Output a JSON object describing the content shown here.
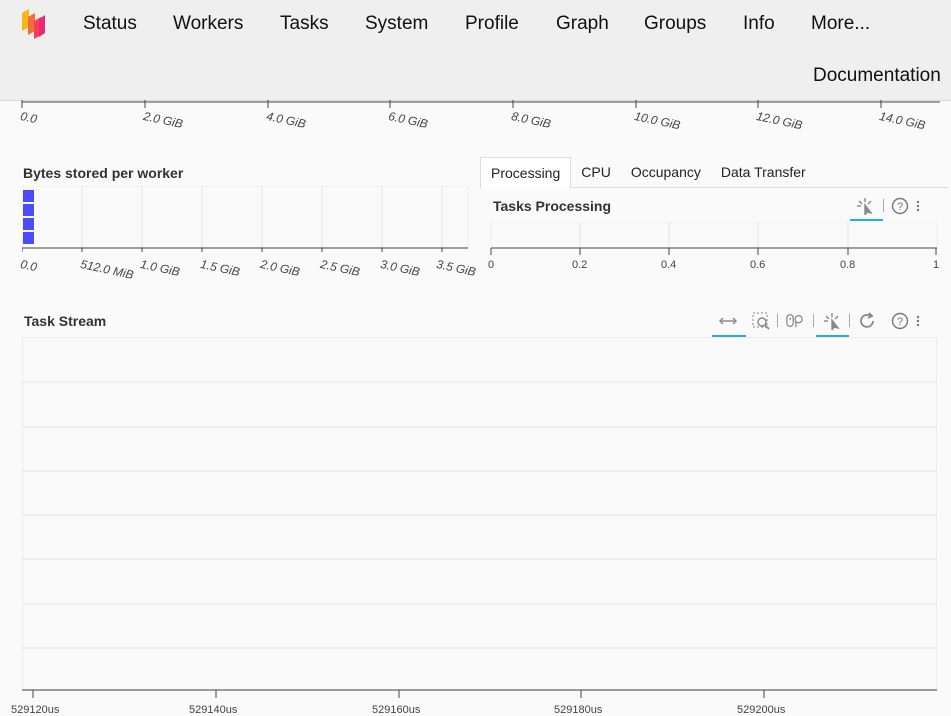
{
  "nav": {
    "items": [
      "Status",
      "Workers",
      "Tasks",
      "System",
      "Profile",
      "Graph",
      "Groups",
      "Info",
      "More..."
    ],
    "documentation": "Documentation"
  },
  "memory_axis": {
    "ticks": [
      "0.0",
      "2.0 GiB",
      "4.0 GiB",
      "6.0 GiB",
      "8.0 GiB",
      "10.0 GiB",
      "12.0 GiB",
      "14.0 GiB"
    ]
  },
  "bytes_stored": {
    "title": "Bytes stored per worker",
    "ticks": [
      "0.0",
      "512.0 MiB",
      "1.0 GiB",
      "1.5 GiB",
      "2.0 GiB",
      "2.5 GiB",
      "3.0 GiB",
      "3.5 GiB"
    ],
    "bar_color": "#4a4aff"
  },
  "tabs": [
    "Processing",
    "CPU",
    "Occupancy",
    "Data Transfer"
  ],
  "active_tab": "Processing",
  "tasks_processing": {
    "title": "Tasks Processing",
    "ticks": [
      "0",
      "0.2",
      "0.4",
      "0.6",
      "0.8",
      "1"
    ]
  },
  "task_stream": {
    "title": "Task Stream",
    "ticks": [
      "529120us",
      "529140us",
      "529160us",
      "529180us",
      "529200us"
    ]
  },
  "colors": {
    "accent": "#26aae1",
    "nav_bg": "#efefef"
  },
  "icons": {
    "pan": "pan-icon",
    "box_zoom": "box-zoom-icon",
    "wheel_zoom": "wheel-zoom-icon",
    "tap": "tap-icon",
    "reset": "reset-icon",
    "help": "help-icon",
    "more": "more-icon"
  }
}
